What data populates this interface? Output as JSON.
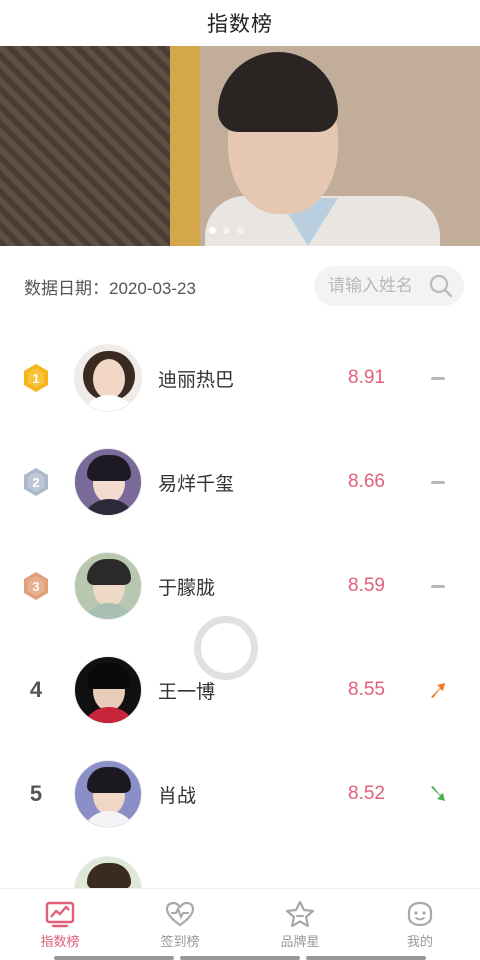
{
  "header": {
    "title": "指数榜"
  },
  "banner": {
    "dots": 3,
    "active_dot": 0
  },
  "filter": {
    "date_label": "数据日期：2020-03-23",
    "search_placeholder": "请输入姓名"
  },
  "ranking": [
    {
      "rank": "1",
      "name": "迪丽热巴",
      "score": "8.91",
      "trend": "flat"
    },
    {
      "rank": "2",
      "name": "易烊千玺",
      "score": "8.66",
      "trend": "flat"
    },
    {
      "rank": "3",
      "name": "于朦胧",
      "score": "8.59",
      "trend": "flat"
    },
    {
      "rank": "4",
      "name": "王一博",
      "score": "8.55",
      "trend": "up"
    },
    {
      "rank": "5",
      "name": "肖战",
      "score": "8.52",
      "trend": "down"
    }
  ],
  "tabs": [
    {
      "label": "指数榜",
      "icon": "chart-icon",
      "active": true
    },
    {
      "label": "签到榜",
      "icon": "heartbeat-icon",
      "active": false
    },
    {
      "label": "品牌星",
      "icon": "star-icon",
      "active": false
    },
    {
      "label": "我的",
      "icon": "smile-face-icon",
      "active": false
    }
  ],
  "colors": {
    "accent": "#e0607a",
    "gold": "#f5b51b",
    "silver": "#aab8c8",
    "bronze": "#e0a07a",
    "up": "#f07a2a",
    "down": "#4caf50",
    "flat": "#b8b8b8"
  }
}
